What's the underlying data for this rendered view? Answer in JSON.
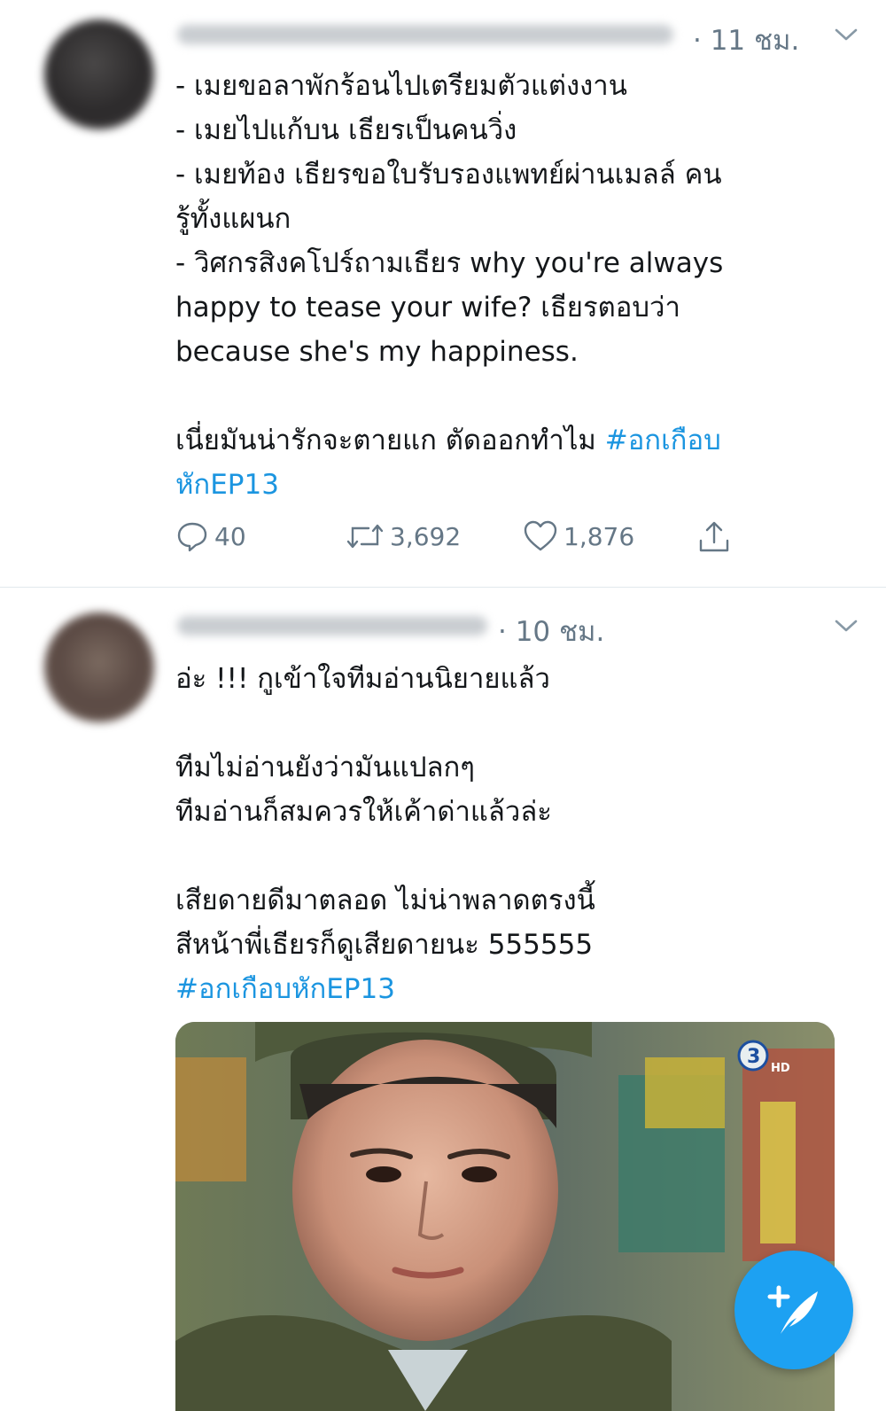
{
  "tweets": [
    {
      "time": "· 11 ชม.",
      "lines": [
        "- เมยขอลาพักร้อนไปเตรียมตัวแต่งงาน",
        "- เมยไปแก้บน เธียรเป็นคนวิ่ง",
        "- เมยท้อง เธียรขอใบรับรองแพทย์ผ่านเมลล์ คน",
        "รู้ทั้งแผนก",
        "- วิศกรสิงคโปร์ถามเธียร why you're always",
        "happy to tease your wife? เธียรตอบว่า",
        "because she's my happiness.",
        "",
        "เนี่ยมันน่ารักจะตายแก ตัดออกทำไม "
      ],
      "hashtag_part1": "#อกเกือบ",
      "hashtag_part2": "หักEP13",
      "stats": {
        "replies": "40",
        "retweets": "3,692",
        "likes": "1,876"
      }
    },
    {
      "time": "· 10 ชม.",
      "lines": [
        "อ่ะ !!! กูเข้าใจทีมอ่านนิยายแล้ว",
        "",
        "ทีมไม่อ่านยังว่ามันแปลกๆ",
        "ทีมอ่านก็สมควรให้เค้าด่าแล้วล่ะ",
        "",
        "เสียดายดีมาตลอด ไม่น่าพลาดตรงนี้",
        "สีหน้าพี่เธียรก็ดูเสียดายนะ 555555"
      ],
      "hashtag": "#อกเกือบหักEP13",
      "media": {
        "logo_text": "3",
        "logo_badge": "HD"
      }
    }
  ],
  "icons": {
    "chevron": "chevron-down-icon",
    "reply": "reply-icon",
    "retweet": "retweet-icon",
    "like": "heart-icon",
    "share": "share-icon",
    "compose": "compose-feather-icon"
  },
  "colors": {
    "accent": "#1da1f2",
    "hashtag": "#1b95e0",
    "muted": "#657786"
  }
}
